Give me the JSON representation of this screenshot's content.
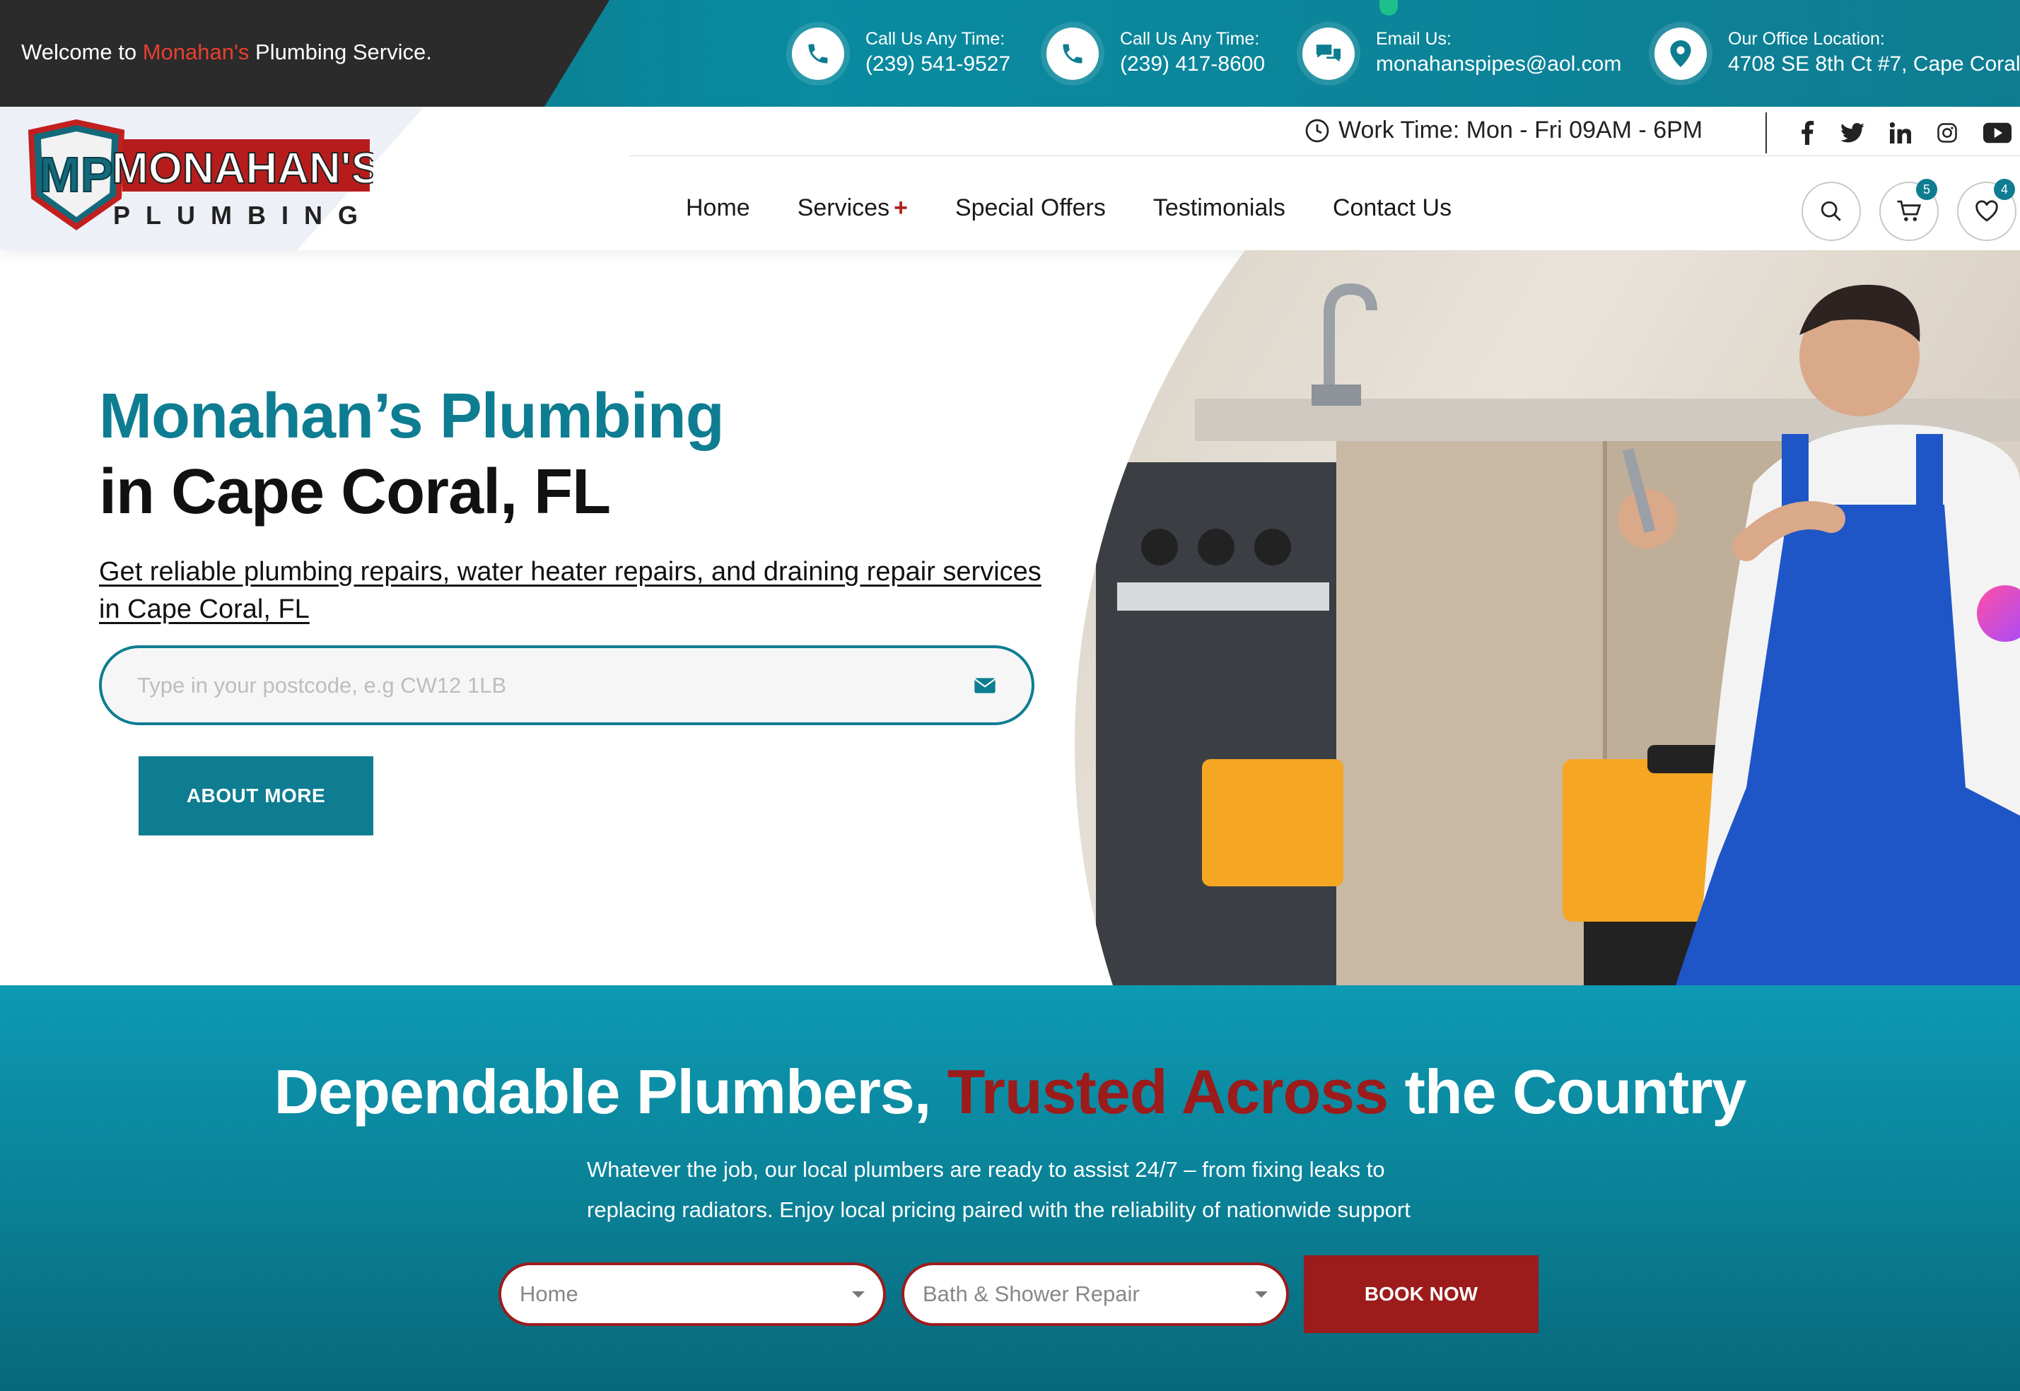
{
  "topbar": {
    "welcome_pre": "Welcome to ",
    "welcome_brand": "Monahan's",
    "welcome_post": " Plumbing Service.",
    "contacts": [
      {
        "icon": "phone-icon",
        "label": "Call Us Any Time:",
        "value": "(239) 541-9527"
      },
      {
        "icon": "phone-icon",
        "label": "Call Us Any Time:",
        "value": "(239) 417-8600"
      },
      {
        "icon": "chat-icon",
        "label": "Email Us:",
        "value": "monahanspipes@aol.com"
      },
      {
        "icon": "location-pin-icon",
        "label": "Our Office Location:",
        "value": "4708 SE 8th Ct #7, Cape Coral,"
      }
    ]
  },
  "header": {
    "logo": {
      "mark": "MP",
      "name": "MONAHAN'S",
      "sub": "PLUMBING"
    },
    "work_time": "Work Time: Mon - Fri 09AM - 6PM",
    "social": [
      "facebook-icon",
      "twitter-icon",
      "linkedin-icon",
      "instagram-icon",
      "youtube-icon"
    ],
    "nav": [
      "Home",
      "Services",
      "Special Offers",
      "Testimonials",
      "Contact Us"
    ],
    "cart_count": "5",
    "wishlist_count": "4"
  },
  "hero": {
    "title_line1": "Monahan’s Plumbing",
    "title_line2": "in Cape Coral, FL",
    "lead": "Get reliable plumbing repairs, water heater repairs, and draining repair services in Cape Coral, FL",
    "postcode_placeholder": "Type in your postcode, e.g CW12 1LB",
    "about_button": "ABOUT MORE"
  },
  "band": {
    "title_pre": "Dependable Plumbers, ",
    "title_red": "Trusted Across",
    "title_post": " the Country",
    "text": "Whatever the job, our local plumbers are ready to assist 24/7 – from fixing leaks to replacing radiators. Enjoy local pricing paired with the reliability of nationwide support",
    "select_property": "Home",
    "select_service": "Bath & Shower Repair",
    "book_button": "BOOK NOW"
  },
  "colors": {
    "teal": "#0e7d92",
    "red": "#9c1b1b",
    "dark": "#2b2b2b"
  }
}
